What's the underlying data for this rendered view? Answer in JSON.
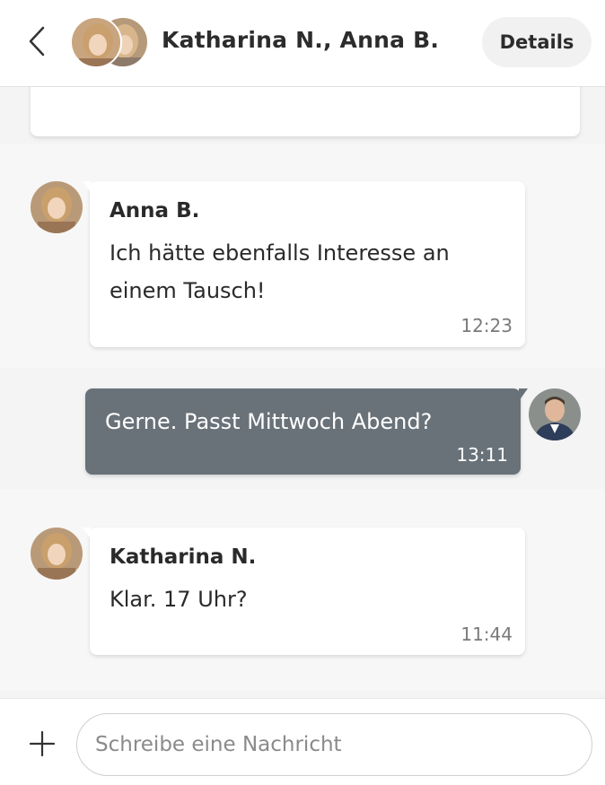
{
  "header": {
    "title": "Katharina N., Anna B.",
    "details_label": "Details",
    "back_icon": "chevron-left-icon"
  },
  "messages": [
    {
      "sender": "Anna B.",
      "text_line1": "Ich hätte ebenfalls Interesse an",
      "text_line2": "einem Tausch!",
      "time": "12:23",
      "direction": "incoming"
    },
    {
      "text": "Gerne. Passt Mittwoch Abend?",
      "time": "13:11",
      "direction": "outgoing"
    },
    {
      "sender": "Katharina N.",
      "text": "Klar. 17 Uhr?",
      "time": "11:44",
      "direction": "incoming"
    }
  ],
  "composer": {
    "placeholder": "Schreibe eine Nachricht",
    "add_icon": "plus-icon"
  },
  "colors": {
    "outgoing_bubble": "#697278",
    "background": "#f4f4f4"
  }
}
